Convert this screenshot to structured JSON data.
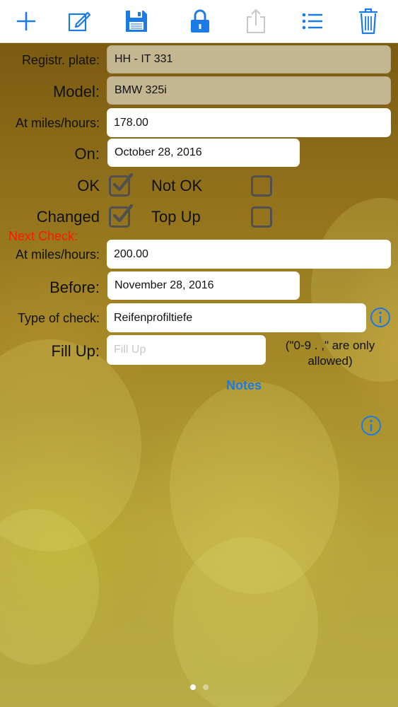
{
  "toolbar": {
    "buttons": [
      {
        "icon": "plus-icon"
      },
      {
        "icon": "edit-icon"
      },
      {
        "icon": "save-icon"
      },
      {
        "icon": "unlock-icon"
      },
      {
        "icon": "share-icon"
      },
      {
        "icon": "list-icon"
      },
      {
        "icon": "trash-icon"
      }
    ],
    "accent": "#1a7ae6",
    "disabled_color": "#c8c8c8"
  },
  "form": {
    "plate_label": "Registr. plate:",
    "plate_value": "HH - IT 331",
    "model_label": "Model:",
    "model_value": "BMW 325i",
    "at_miles_label": "At miles/hours:",
    "at_miles_value": "178.00",
    "on_label": "On:",
    "on_value": "October 28, 2016",
    "ok_label": "OK",
    "not_ok_label": "Not OK",
    "changed_label": "Changed",
    "top_up_label": "Top Up",
    "ok_checked": true,
    "not_ok_checked": false,
    "changed_checked": true,
    "top_up_checked": false,
    "next_check_label": "Next Check:",
    "next_miles_label": "At miles/hours:",
    "next_miles_value": "200.00",
    "before_label": "Before:",
    "before_value": "November 28, 2016",
    "type_label": "Type of check:",
    "type_value": "Reifenprofiltiefe",
    "fill_up_label": "Fill Up:",
    "fill_up_placeholder": "Fill Up",
    "fill_up_hint": "(\"0-9 . ,\" are only allowed)",
    "notes_label": "Notes"
  },
  "pager": {
    "pages": 2,
    "current": 1
  }
}
